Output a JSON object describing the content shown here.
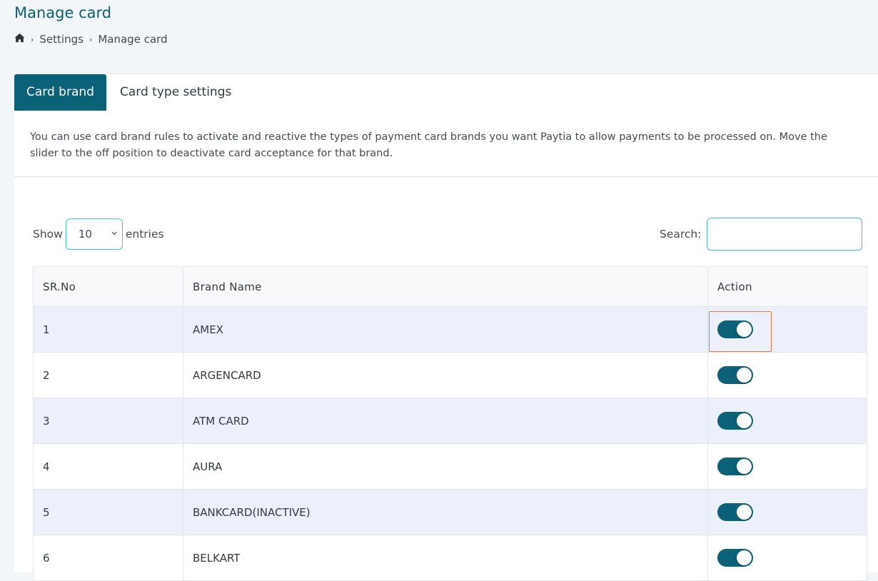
{
  "page": {
    "title": "Manage card"
  },
  "breadcrumb": {
    "home_icon": "home-icon",
    "items": [
      "Settings",
      "Manage card"
    ]
  },
  "tabs": [
    {
      "label": "Card brand",
      "active": true
    },
    {
      "label": "Card type settings",
      "active": false
    }
  ],
  "info": {
    "text": "You can use card brand rules to activate and reactive the types of payment card brands you want Paytia to allow payments to be processed on. Move the slider to the off position to deactivate card acceptance for that brand."
  },
  "table_controls": {
    "show_label": "Show",
    "entries_value": "10",
    "entries_label": "entries",
    "search_label": "Search:",
    "search_value": ""
  },
  "table": {
    "columns": [
      "SR.No",
      "Brand Name",
      "Action"
    ],
    "rows": [
      {
        "sr": "1",
        "brand": "AMEX",
        "enabled": true,
        "highlighted": true
      },
      {
        "sr": "2",
        "brand": "ARGENCARD",
        "enabled": true,
        "highlighted": false
      },
      {
        "sr": "3",
        "brand": "ATM CARD",
        "enabled": true,
        "highlighted": false
      },
      {
        "sr": "4",
        "brand": "AURA",
        "enabled": true,
        "highlighted": false
      },
      {
        "sr": "5",
        "brand": "BANKCARD(INACTIVE)",
        "enabled": true,
        "highlighted": false
      },
      {
        "sr": "6",
        "brand": "BELKART",
        "enabled": true,
        "highlighted": false
      }
    ]
  },
  "colors": {
    "primary": "#0b6177",
    "input_border": "#3cc5d4",
    "row_striped": "#ebf0fa",
    "highlight_border": "#e8763a"
  }
}
